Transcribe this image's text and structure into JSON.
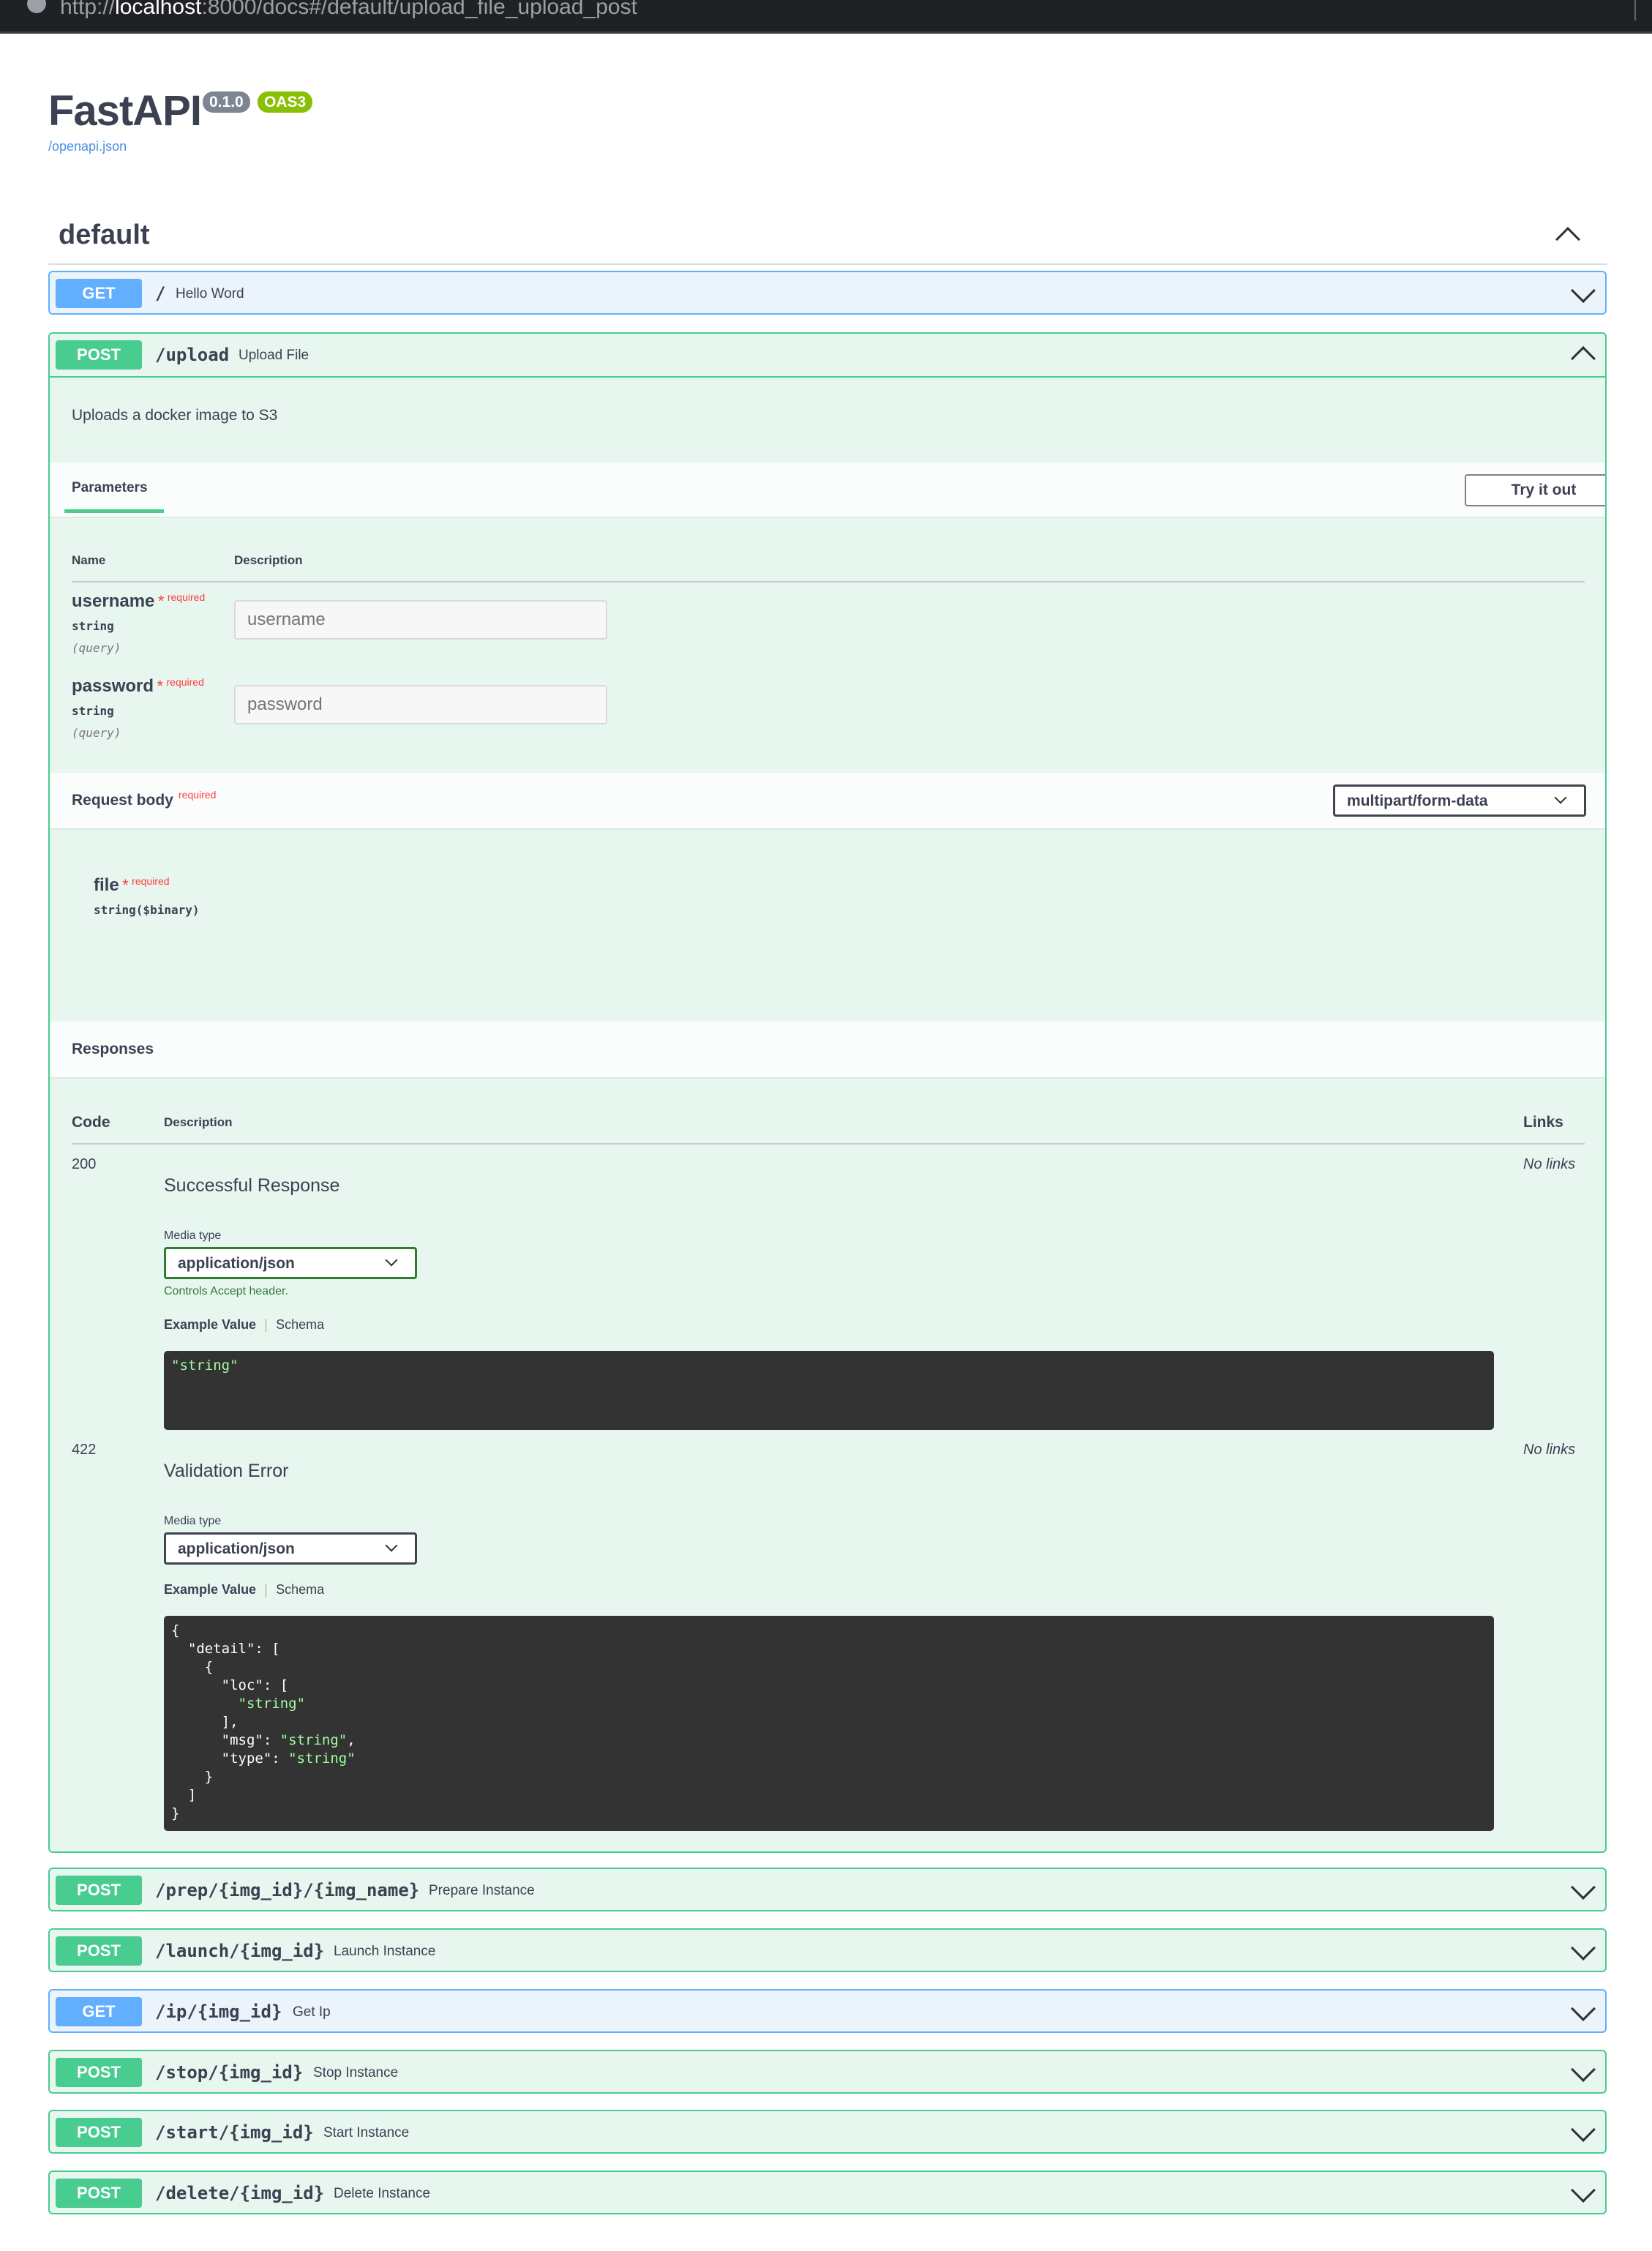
{
  "url_bar": {
    "prefix": "http://",
    "host": "localhost",
    "rest": ":8000/docs#/default/upload_file_upload_post"
  },
  "header": {
    "title": "FastAPI",
    "version": "0.1.0",
    "oas": "OAS3",
    "spec_link": "/openapi.json"
  },
  "tag": {
    "name": "default"
  },
  "ops": [
    {
      "method": "GET",
      "path": "/",
      "summary": "Hello Word"
    },
    {
      "method": "POST",
      "path": "/upload",
      "summary": "Upload File"
    },
    {
      "method": "POST",
      "path": "/prep/{img_id}/{img_name}",
      "summary": "Prepare Instance"
    },
    {
      "method": "POST",
      "path": "/launch/{img_id}",
      "summary": "Launch Instance"
    },
    {
      "method": "GET",
      "path": "/ip/{img_id}",
      "summary": "Get Ip"
    },
    {
      "method": "POST",
      "path": "/stop/{img_id}",
      "summary": "Stop Instance"
    },
    {
      "method": "POST",
      "path": "/start/{img_id}",
      "summary": "Start Instance"
    },
    {
      "method": "POST",
      "path": "/delete/{img_id}",
      "summary": "Delete Instance"
    }
  ],
  "upload": {
    "description": "Uploads a docker image to S3",
    "parameters_tab": "Parameters",
    "try_button": "Try it out",
    "col_name": "Name",
    "col_description": "Description",
    "required": "required",
    "params": [
      {
        "name": "username",
        "type": "string",
        "in": "(query)",
        "placeholder": "username"
      },
      {
        "name": "password",
        "type": "string",
        "in": "(query)",
        "placeholder": "password"
      }
    ],
    "request_body": "Request body",
    "content_type": "multipart/form-data",
    "file_field": {
      "name": "file",
      "type": "string($binary)"
    },
    "responses_title": "Responses",
    "resp_cols": {
      "code": "Code",
      "description": "Description",
      "links": "Links"
    },
    "media_type_label": "Media type",
    "controls_text": "Controls Accept header.",
    "example_tab": "Example Value",
    "schema_tab": "Schema",
    "responses": [
      {
        "code": "200",
        "description": "Successful Response",
        "links": "No links",
        "media_type": "application/json"
      },
      {
        "code": "422",
        "description": "Validation Error",
        "links": "No links",
        "media_type": "application/json"
      }
    ],
    "example_200": "\"string\"",
    "example_422": [
      "{",
      "  \"detail\": [",
      "    {",
      "      \"loc\": [",
      "        \"string\"",
      "      ],",
      "      \"msg\": \"string\",",
      "      \"type\": \"string\"",
      "    }",
      "  ]",
      "}"
    ]
  }
}
